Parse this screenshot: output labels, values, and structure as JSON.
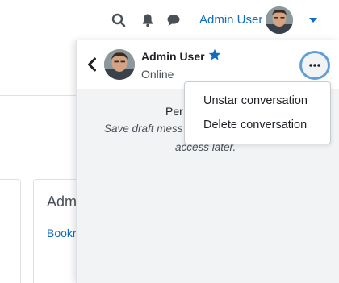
{
  "navbar": {
    "user_name": "Admin User",
    "icons": [
      "search-icon",
      "bell-icon",
      "chat-icon",
      "caret-down-icon"
    ]
  },
  "page": {
    "card_title": "Adm",
    "card_link": "Bookr"
  },
  "conversation": {
    "name": "Admin User",
    "status": "Online",
    "starred": true,
    "icons": [
      "back-chevron-icon",
      "star-icon",
      "more-options-icon"
    ]
  },
  "drawer_text": {
    "line1": "Per",
    "line2": "Save draft mess",
    "line3": "access later."
  },
  "dropdown": {
    "items": [
      {
        "label": "Unstar conversation"
      },
      {
        "label": "Delete conversation"
      }
    ]
  },
  "colors": {
    "brand": "#0f6cbf",
    "drawer_bg": "#f1f3f5",
    "focus_ring": "#5e9fd6"
  }
}
